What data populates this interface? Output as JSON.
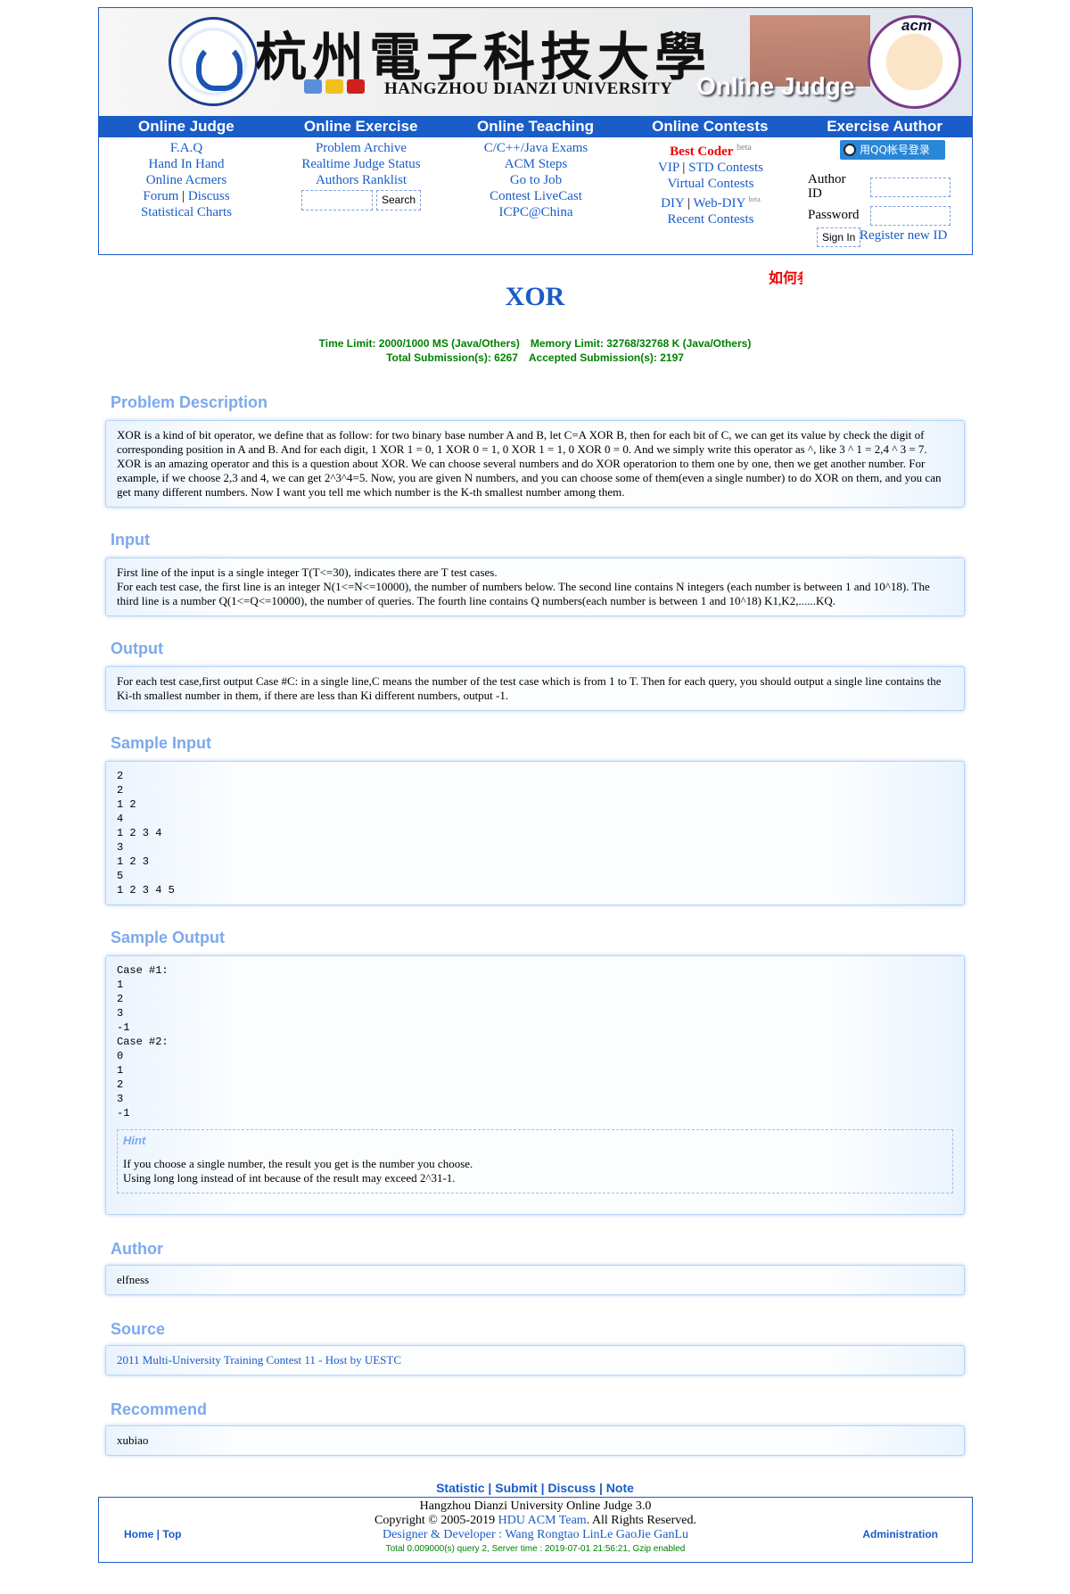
{
  "header": {
    "university_cn": "杭州電子科技大學",
    "university_en": "HANGZHOU DIANZI UNIVERSITY",
    "oj_title": "Online Judge",
    "acm_logo_text": "acm",
    "nav": [
      "Online Judge",
      "Online Exercise",
      "Online Teaching",
      "Online Contests",
      "Exercise Author"
    ],
    "col_judge": [
      "F.A.Q",
      "Hand In Hand",
      "Online Acmers"
    ],
    "forum": "Forum",
    "discuss": "Discuss",
    "statistical_charts": "Statistical Charts",
    "col_exercise": [
      "Problem Archive",
      "Realtime Judge Status",
      "Authors Ranklist"
    ],
    "search_button": "Search",
    "col_teaching": [
      "C/C++/Java Exams",
      "ACM Steps",
      "Go to Job",
      "Contest LiveCast",
      "ICPC@China"
    ],
    "best_coder": "Best Coder",
    "beta": "beta",
    "vip": "VIP",
    "std_contests": "STD Contests",
    "virtual_contests": "Virtual Contests",
    "diy": "DIY",
    "web_diy": "Web-DIY",
    "recent_contests": "Recent Contests",
    "qq_login": "用QQ帐号登录",
    "author_id_label": "Author ID",
    "password_label": "Password",
    "sign_in": "Sign In",
    "register": "Register new ID"
  },
  "marquee": "如何参",
  "problem": {
    "title": "XOR",
    "time_limit": "Time Limit: 2000/1000 MS (Java/Others)",
    "memory_limit": "Memory Limit: 32768/32768 K (Java/Others)",
    "total_submissions": "Total Submission(s): 6267",
    "accepted_submissions": "Accepted Submission(s): 2197",
    "description_title": "Problem Description",
    "description": "XOR is a kind of bit operator, we define that as follow: for two binary base number A and B, let C=A XOR B, then for each bit of C, we can get its value by check the digit of corresponding position in A and B. And for each digit, 1 XOR 1 = 0, 1 XOR 0 = 1, 0 XOR 1 = 1, 0 XOR 0 = 0. And we simply write this operator as ^, like 3 ^ 1 = 2,4 ^ 3 = 7. XOR is an amazing operator and this is a question about XOR. We can choose several numbers and do XOR operatorion to them one by one, then we get another number. For example, if we choose 2,3 and 4, we can get 2^3^4=5. Now, you are given N numbers, and you can choose some of them(even a single number) to do XOR on them, and you can get many different numbers. Now I want you tell me which number is the K-th smallest number among them.",
    "input_title": "Input",
    "input_line1": "First line of the input is a single integer T(T<=30), indicates there are T test cases.",
    "input_line2": "For each test case, the first line is an integer N(1<=N<=10000), the number of numbers below. The second line contains N integers (each number is between 1 and 10^18). The third line is a number Q(1<=Q<=10000), the number of queries. The fourth line contains Q numbers(each number is between 1 and 10^18) K1,K2,......KQ.",
    "output_title": "Output",
    "output": "For each test case,first output Case #C: in a single line,C means the number of the test case which is from 1 to T. Then for each query, you should output a single line contains the Ki-th smallest number in them, if there are less than Ki different numbers, output -1.",
    "sample_input_title": "Sample Input",
    "sample_input": "2\n2\n1 2\n4\n1 2 3 4\n3\n1 2 3\n5\n1 2 3 4 5",
    "sample_output_title": "Sample Output",
    "sample_output": "Case #1:\n1\n2\n3\n-1\nCase #2:\n0\n1\n2\n3\n-1",
    "hint_label": "Hint",
    "hint_line1": "If you choose a single number, the result you get is the number you choose.",
    "hint_line2": "Using long long instead of int because of the result may exceed 2^31-1.",
    "author_title": "Author",
    "author": "elfness",
    "source_title": "Source",
    "source": "2011 Multi-University Training Contest 11 - Host by UESTC",
    "recommend_title": "Recommend",
    "recommend": "xubiao"
  },
  "bottom_links": [
    "Statistic",
    "Submit",
    "Discuss",
    "Note"
  ],
  "footer": {
    "home": "Home",
    "top": "Top",
    "line1": "Hangzhou Dianzi University Online Judge 3.0",
    "copyright": "Copyright © 2005-2019",
    "team": "HDU ACM Team",
    "rights": ". All Rights Reserved.",
    "designer": "Designer & Developer : Wang Rongtao LinLe GaoJie GanLu",
    "stats": "Total 0.009000(s) query 2, Server time : 2019-07-01 21:56:21, Gzip enabled",
    "admin": "Administration"
  }
}
